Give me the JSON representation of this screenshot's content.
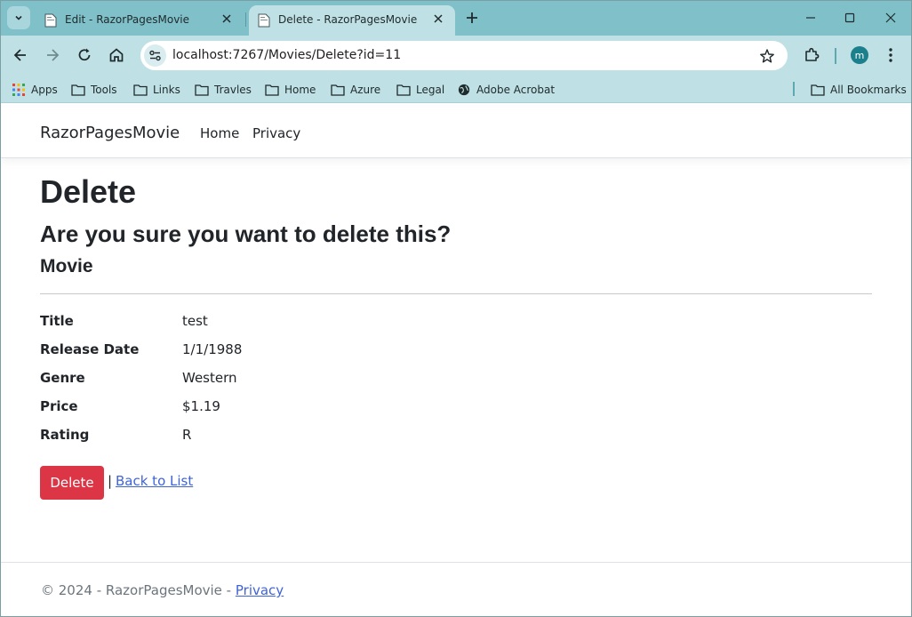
{
  "browser": {
    "tabs": [
      {
        "title": "Edit - RazorPagesMovie",
        "active": false
      },
      {
        "title": "Delete - RazorPagesMovie",
        "active": true
      }
    ],
    "address": "localhost:7267/Movies/Delete?id=11",
    "profile_initial": "m",
    "bookmarks": [
      {
        "label": "Apps",
        "icon": "apps-grid-icon"
      },
      {
        "label": "Tools",
        "icon": "folder-icon"
      },
      {
        "label": "Links",
        "icon": "folder-icon"
      },
      {
        "label": "Travles",
        "icon": "folder-icon"
      },
      {
        "label": "Home",
        "icon": "folder-icon"
      },
      {
        "label": "Azure",
        "icon": "folder-icon"
      },
      {
        "label": "Legal",
        "icon": "folder-icon"
      },
      {
        "label": "Adobe Acrobat",
        "icon": "globe-icon"
      }
    ],
    "all_bookmarks": "All Bookmarks"
  },
  "site": {
    "brand": "RazorPagesMovie",
    "nav": [
      "Home",
      "Privacy"
    ]
  },
  "main": {
    "heading": "Delete",
    "question": "Are you sure you want to delete this?",
    "entity": "Movie",
    "fields": [
      {
        "label": "Title",
        "value": "test"
      },
      {
        "label": "Release Date",
        "value": "1/1/1988"
      },
      {
        "label": "Genre",
        "value": "Western"
      },
      {
        "label": "Price",
        "value": "$1.19"
      },
      {
        "label": "Rating",
        "value": "R"
      }
    ],
    "delete_button": "Delete",
    "separator": "|",
    "back_link": "Back to List"
  },
  "footer": {
    "text": "© 2024 - RazorPagesMovie - ",
    "privacy_link": "Privacy"
  },
  "colors": {
    "danger": "#dc3545",
    "link": "#3f63d8",
    "chrome_tabstrip": "#7fc0c9",
    "chrome_toolbar": "#bfe1e5"
  }
}
